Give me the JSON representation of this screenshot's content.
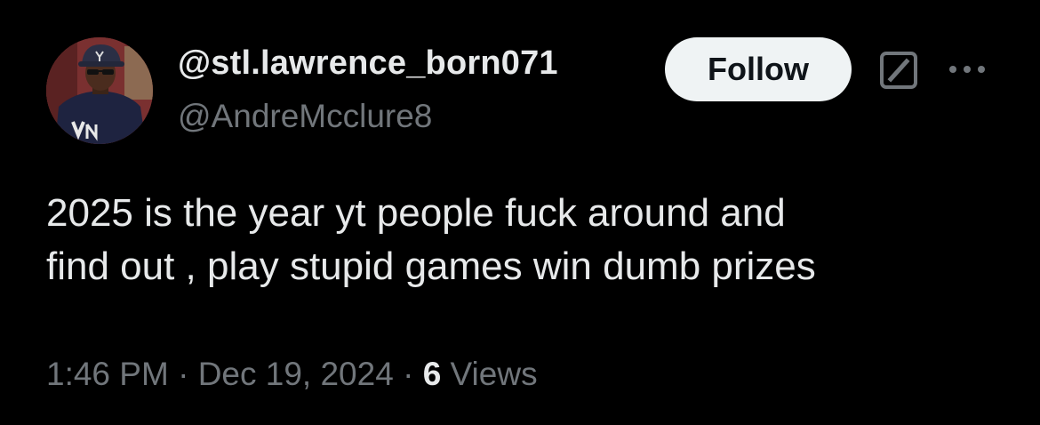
{
  "author": {
    "display_name": "@stl.lawrence_born071",
    "handle": "@AndreMcclure8",
    "avatar_icon": "profile-photo"
  },
  "actions": {
    "follow_label": "Follow",
    "grok_icon": "grok-icon",
    "more_icon": "more-options-icon"
  },
  "tweet": {
    "text_line_1": "2025 is the year yt people fuck around and",
    "text_line_2": "find out , play stupid games win dumb prizes"
  },
  "meta": {
    "time": "1:46 PM",
    "separator": "·",
    "date": "Dec 19, 2024",
    "views_count": "6",
    "views_label": "Views"
  },
  "colors": {
    "background": "#000000",
    "primary_text": "#e7e9ea",
    "secondary_text": "#71767b",
    "follow_button_bg": "#eff3f4",
    "follow_button_text": "#0f1419"
  }
}
